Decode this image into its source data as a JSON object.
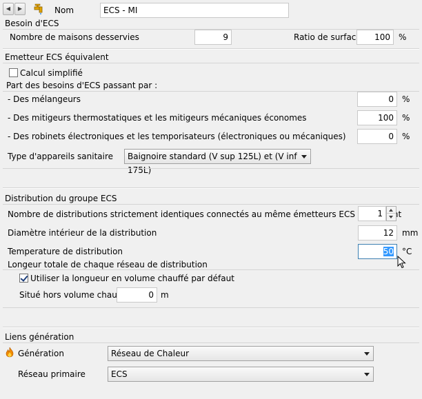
{
  "header": {
    "prev_icon": "triangle-left",
    "next_icon": "triangle-right",
    "tap_icon": "water-tap-icon",
    "nom_label": "Nom",
    "nom_value": "ECS - MI"
  },
  "besoin": {
    "title": "Besoin d'ECS",
    "maisons_label": "Nombre de maisons desservies",
    "maisons_value": "9",
    "ratio_label": "Ratio de surface",
    "ratio_value": "100",
    "ratio_unit": "%"
  },
  "emetteur": {
    "title": "Emetteur ECS équivalent",
    "calcul_label": "Calcul simplifié",
    "calcul_checked": false,
    "part_label": "Part des besoins d'ECS passant par :",
    "rows": [
      {
        "label": "- Des mélangeurs",
        "value": "0",
        "unit": "%"
      },
      {
        "label": "- Des mitigeurs thermostatiques et les mitigeurs mécaniques économes",
        "value": "100",
        "unit": "%"
      },
      {
        "label": "- Des robinets électroniques et les temporisateurs (électroniques ou mécaniques)",
        "value": "0",
        "unit": "%"
      }
    ],
    "type_label": "Type d'appareils sanitaire",
    "type_value": "Baignoire standard (V sup 125L) et (V inf 175L)"
  },
  "distribution": {
    "title": "Distribution du groupe ECS",
    "nb_label": "Nombre de distributions strictement identiques connectés au même émetteurs ECS équivalent",
    "nb_value": "1",
    "diam_label": "Diamètre intérieur de la distribution",
    "diam_value": "12",
    "diam_unit": "mm",
    "temp_label": "Temperature de distribution",
    "temp_value": "50",
    "temp_unit": "°C",
    "longueur_label": "Longeur totale de chaque réseau de distribution",
    "utiliser_label": "Utiliser la longueur en volume chauffé par défaut",
    "utiliser_checked": true,
    "situe_label": "Situé hors volume chauffé",
    "situe_value": "0",
    "situe_unit": "m"
  },
  "liens": {
    "title": "Liens génération",
    "generation_icon": "flame-icon",
    "generation_label": "Génération",
    "generation_value": "Réseau de Chaleur",
    "reseau_label": "Réseau primaire",
    "reseau_value": "ECS"
  }
}
